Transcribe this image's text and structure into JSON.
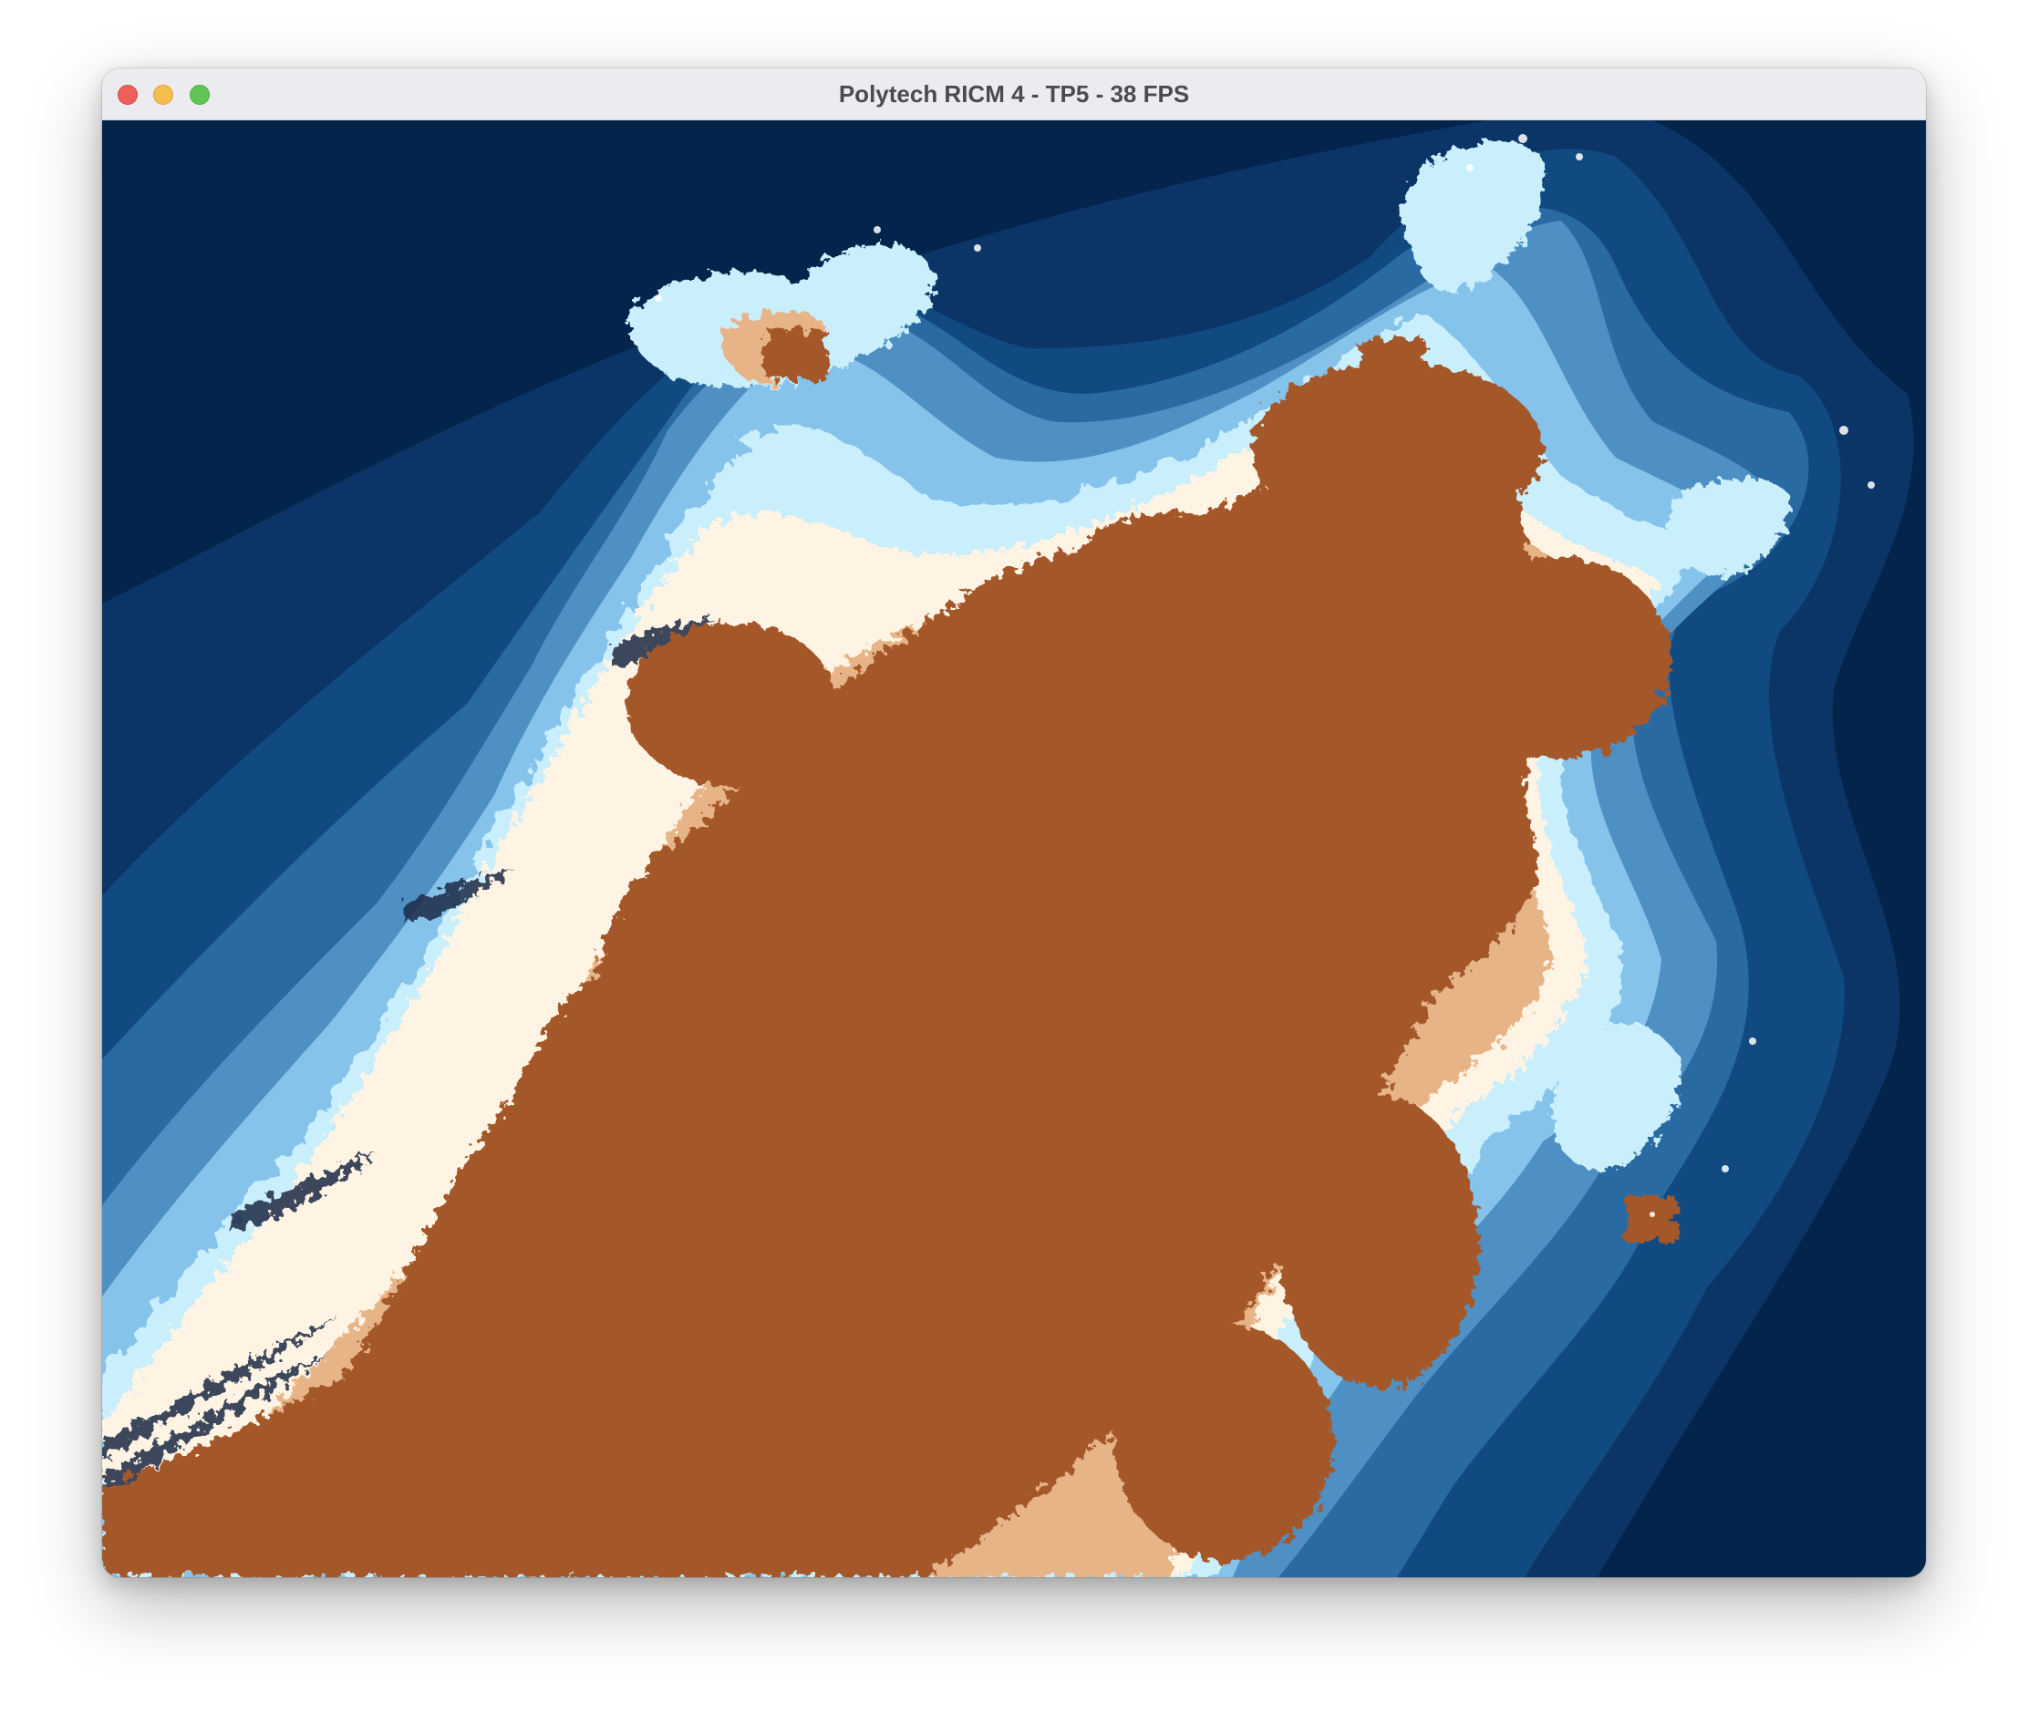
{
  "window": {
    "title": "Polytech RICM 4 - TP5 - 38 FPS"
  },
  "controls": {
    "close": "close-icon",
    "minimize": "minimize-icon",
    "maximize": "maximize-icon"
  },
  "render": {
    "description_type": "fractal-render",
    "colors": {
      "interior": "#a4582c",
      "band_0": "#03244b",
      "band_1": "#0b3567",
      "band_2": "#114a80",
      "band_3": "#2a6aa2",
      "band_4": "#4f90c4",
      "band_5": "#86c3ea",
      "band_6": "#c9eefc",
      "band_7": "#fff4e4",
      "band_8": "#e7b488"
    }
  }
}
